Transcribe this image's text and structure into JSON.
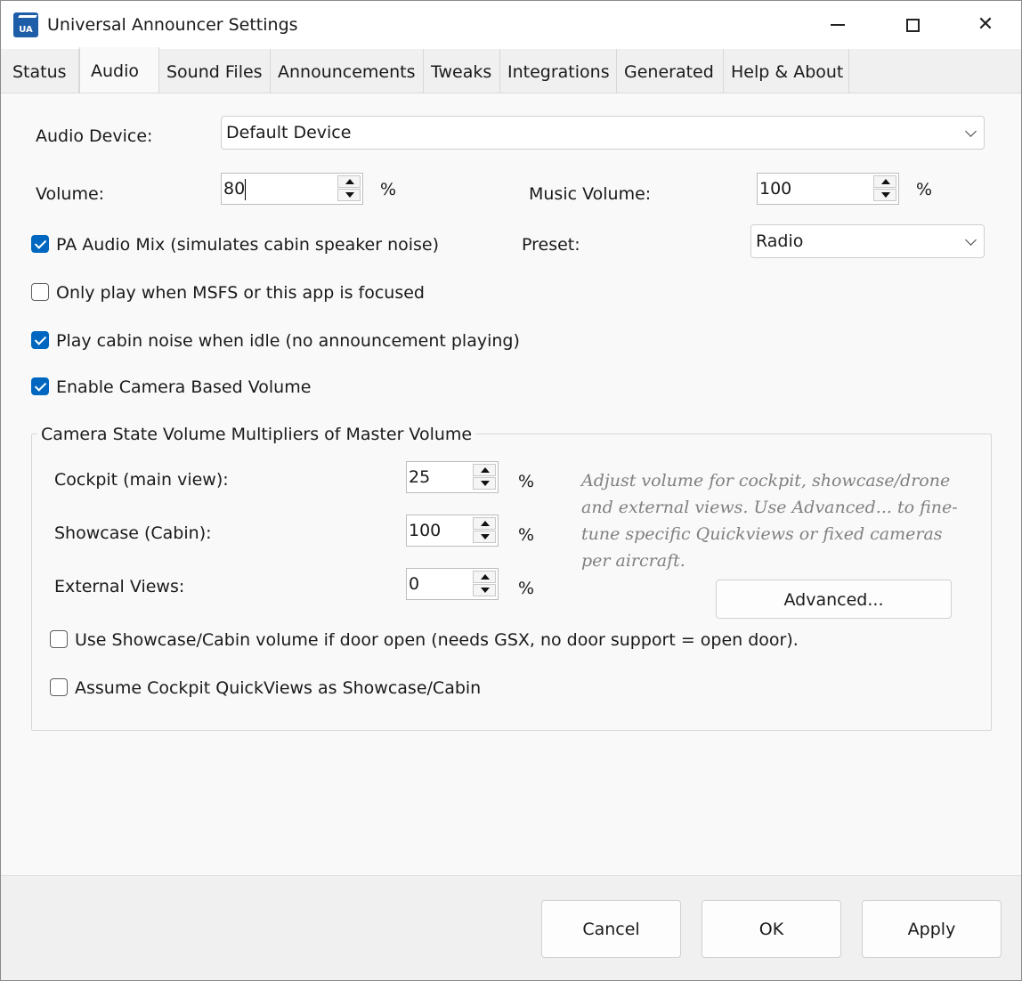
{
  "window": {
    "title": "Universal Announcer Settings",
    "icon_text": "UA",
    "close_glyph": "✕"
  },
  "tabs": [
    {
      "label": "Status"
    },
    {
      "label": "Audio"
    },
    {
      "label": "Sound Files"
    },
    {
      "label": "Announcements"
    },
    {
      "label": "Tweaks"
    },
    {
      "label": "Integrations"
    },
    {
      "label": "Generated"
    },
    {
      "label": "Help & About"
    }
  ],
  "active_tab": "Audio",
  "audio": {
    "device_label": "Audio Device:",
    "device_value": "Default Device",
    "volume_label": "Volume:",
    "volume_value": "80",
    "volume_unit": "%",
    "music_volume_label": "Music Volume:",
    "music_volume_value": "100",
    "music_volume_unit": "%",
    "pa_mix_label": "PA Audio Mix (simulates cabin speaker noise)",
    "pa_mix_checked": true,
    "preset_label": "Preset:",
    "preset_value": "Radio",
    "focus_only_label": "Only play when MSFS or this app is focused",
    "focus_only_checked": false,
    "cabin_noise_label": "Play cabin noise when idle (no announcement playing)",
    "cabin_noise_checked": true,
    "camera_volume_label": "Enable Camera Based Volume",
    "camera_volume_checked": true
  },
  "camera_group": {
    "title": "Camera State Volume Multipliers of Master Volume",
    "cockpit_label": "Cockpit (main view):",
    "cockpit_value": "25",
    "showcase_label": "Showcase (Cabin):",
    "showcase_value": "100",
    "external_label": "External Views:",
    "external_value": "0",
    "unit": "%",
    "hint": "Adjust volume for cockpit, showcase/drone and external views. Use Advanced... to fine-tune specific Quickviews or fixed cameras per aircraft.",
    "advanced_label": "Advanced...",
    "door_open_label": "Use Showcase/Cabin volume if door open (needs GSX, no door support = open door).",
    "door_open_checked": false,
    "quickviews_label": "Assume Cockpit QuickViews as Showcase/Cabin",
    "quickviews_checked": false
  },
  "footer": {
    "cancel_label": "Cancel",
    "ok_label": "OK",
    "apply_label": "Apply"
  },
  "colors": {
    "accent": "#0067c0",
    "hint_text": "#808080"
  }
}
